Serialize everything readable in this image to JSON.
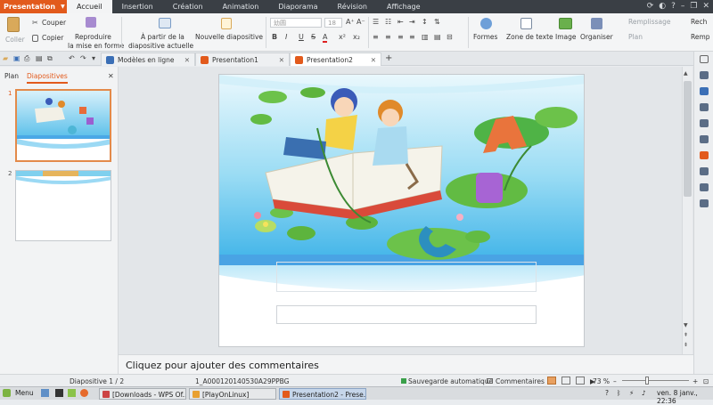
{
  "menubar": {
    "app_label": "Presentation",
    "tabs": [
      {
        "label": "Accueil",
        "active": true
      },
      {
        "label": "Insertion"
      },
      {
        "label": "Création"
      },
      {
        "label": "Animation"
      },
      {
        "label": "Diaporama"
      },
      {
        "label": "Révision"
      },
      {
        "label": "Affichage"
      }
    ]
  },
  "ribbon": {
    "coller": "Coller",
    "couper": "Couper",
    "copier": "Copier",
    "reproduire_1": "Reproduire",
    "reproduire_2": "la mise en forme",
    "a_partir_1": "À partir de la",
    "a_partir_2": "diapositive actuelle",
    "nouvelle_diapo": "Nouvelle diapositive",
    "font_name": "幼圆",
    "font_size": "18",
    "bold": "B",
    "italic": "I",
    "underline": "U",
    "strike": "S",
    "formes": "Formes",
    "zone_texte": "Zone de texte",
    "image": "Image",
    "organiser": "Organiser",
    "remplissage": "Remplissage",
    "plan": "Plan",
    "rech": "Rech",
    "remp": "Remp"
  },
  "tabs": [
    {
      "label": "Modèles en ligne",
      "color": "#3b6fb6"
    },
    {
      "label": "Presentation1",
      "color": "#e25a1c"
    },
    {
      "label": "Presentation2",
      "color": "#e25a1c",
      "active": true
    }
  ],
  "leftpanel": {
    "plan_tab": "Plan",
    "diapositives_tab": "Diapositives",
    "slide_numbers": [
      "1",
      "2"
    ]
  },
  "notes": {
    "placeholder": "Cliquez pour ajouter des commentaires"
  },
  "status": {
    "slide_count": "Diapositive 1 / 2",
    "template": "1_A000120140530A29PPBG",
    "autosave": "Sauvegarde automatique",
    "comments": "Commentaires",
    "zoom": "73 %"
  },
  "taskbar": {
    "menu": "Menu",
    "tasks": [
      {
        "label": "[Downloads - WPS Of..."
      },
      {
        "label": "[PlayOnLinux]"
      },
      {
        "label": "Presentation2 - Prese...",
        "active": true
      }
    ],
    "clock": "ven. 8 janv., 22:36"
  },
  "colors": {
    "accent": "#e25a1c",
    "sky": "#7fd0ee",
    "water": "#3fa0df"
  }
}
